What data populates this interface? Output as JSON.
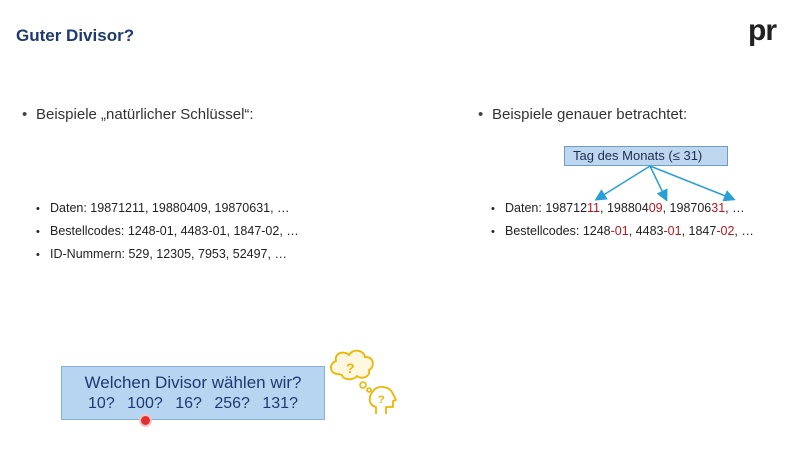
{
  "slide": {
    "title": "Guter Divisor?",
    "logo": "pr",
    "left": {
      "heading": "Beispiele „natürlicher Schlüssel“:",
      "items": [
        {
          "label": "Daten: 19871211, 19880409, 19870631, …"
        },
        {
          "label": "Bestellcodes: 1248-01, 4483-01, 1847-02, …"
        },
        {
          "label": "ID-Nummern: 529, 12305, 7953, 52497, …"
        }
      ]
    },
    "right": {
      "heading": "Beispiele genauer betrachtet:",
      "tag_box": "Tag des Monats (≤ 31)",
      "dates": {
        "prefix": "Daten: ",
        "v1_base": "198712",
        "v1_hi": "11",
        "v2_base": "198804",
        "v2_hi": "09",
        "v3_base": "198706",
        "v3_hi": "31",
        "suffix": ", …"
      },
      "codes": {
        "prefix": "Bestellcodes: ",
        "c1_base": "1248",
        "c1_hi": "-01",
        "c2_base": "4483",
        "c2_hi": "-01",
        "c3_base": "1847",
        "c3_hi": "-02",
        "suffix": ", …"
      }
    },
    "question": {
      "line1": "Welchen Divisor wählen wir?",
      "line2": "10?  100?  16?  256?  131?"
    },
    "bullet": "•",
    "colors": {
      "title": "#1f3a6e",
      "highlight": "#c0141c",
      "arrow": "#2a9fd6",
      "box_fill": "#b6d5f0",
      "thinker": "#f0b400"
    },
    "icons": {
      "thinker": "thinking-head-icon",
      "pointer": "laser-pointer-icon"
    }
  }
}
